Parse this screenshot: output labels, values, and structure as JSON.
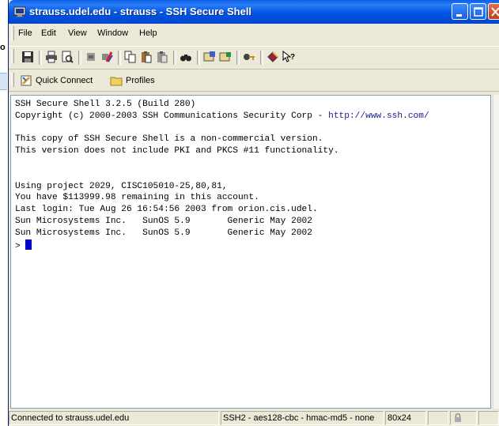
{
  "window": {
    "title": "strauss.udel.edu - strauss - SSH Secure Shell"
  },
  "background": {
    "label": "o"
  },
  "menu": {
    "items": [
      {
        "label": "File"
      },
      {
        "label": "Edit"
      },
      {
        "label": "View"
      },
      {
        "label": "Window"
      },
      {
        "label": "Help"
      }
    ]
  },
  "toolbar": {
    "icons": [
      "save-icon",
      "print-icon",
      "print-preview-icon",
      "connect-icon",
      "disconnect-icon",
      "copy-icon",
      "paste-icon",
      "paste-alt-icon",
      "find-icon",
      "settings-icon",
      "profile-settings-icon",
      "key-icon",
      "help-book-icon",
      "context-help-icon"
    ]
  },
  "links": {
    "quick_connect": "Quick Connect",
    "profiles": "Profiles"
  },
  "terminal": {
    "lines": [
      "SSH Secure Shell 3.2.5 (Build 280)",
      "Copyright (c) 2000-2003 SSH Communications Security Corp - ",
      "",
      "This copy of SSH Secure Shell is a non-commercial version.",
      "This version does not include PKI and PKCS #11 functionality.",
      "",
      "",
      "Using project 2029, CISC105010-25,80,81,",
      "You have $113999.98 remaining in this account.",
      "Last login: Tue Aug 26 16:54:56 2003 from orion.cis.udel.",
      "Sun Microsystems Inc.   SunOS 5.9       Generic May 2002",
      "Sun Microsystems Inc.   SunOS 5.9       Generic May 2002"
    ],
    "copyright_url": "http://www.ssh.com/",
    "prompt": "> "
  },
  "status": {
    "connection": "Connected to strauss.udel.edu",
    "cipher": "SSH2 - aes128-cbc - hmac-md5 - none",
    "size": "80x24"
  }
}
